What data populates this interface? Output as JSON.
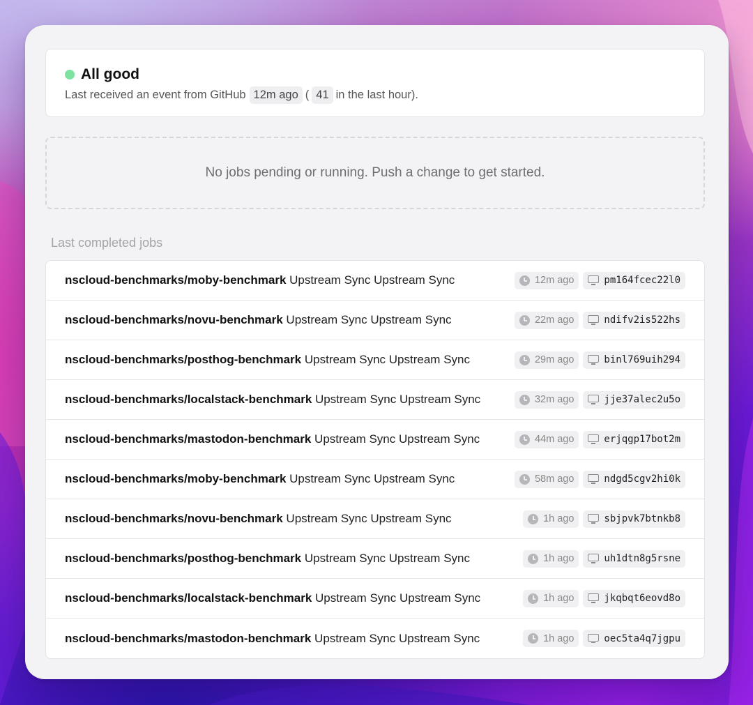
{
  "status": {
    "title": "All good",
    "line_prefix": "Last received an event from GitHub",
    "last_event": "12m ago",
    "open_paren": "(",
    "event_count": "41",
    "line_suffix": "in the last hour).",
    "indicator_color": "#7ee2a0"
  },
  "empty_state": {
    "message": "No jobs pending or running. Push a change to get started."
  },
  "completed": {
    "section_label": "Last completed jobs",
    "jobs": [
      {
        "repo": "nscloud-benchmarks/moby-benchmark",
        "title": "Upstream Sync Upstream Sync",
        "time": "12m ago",
        "id": "pm164fcec22l0"
      },
      {
        "repo": "nscloud-benchmarks/novu-benchmark",
        "title": "Upstream Sync Upstream Sync",
        "time": "22m ago",
        "id": "ndifv2is522hs"
      },
      {
        "repo": "nscloud-benchmarks/posthog-benchmark",
        "title": "Upstream Sync Upstream Sync",
        "time": "29m ago",
        "id": "binl769uih294"
      },
      {
        "repo": "nscloud-benchmarks/localstack-benchmark",
        "title": "Upstream Sync Upstream Sync",
        "time": "32m ago",
        "id": "jje37alec2u5o"
      },
      {
        "repo": "nscloud-benchmarks/mastodon-benchmark",
        "title": "Upstream Sync Upstream Sync",
        "time": "44m ago",
        "id": "erjqgp17bot2m"
      },
      {
        "repo": "nscloud-benchmarks/moby-benchmark",
        "title": "Upstream Sync Upstream Sync",
        "time": "58m ago",
        "id": "ndgd5cgv2hi0k"
      },
      {
        "repo": "nscloud-benchmarks/novu-benchmark",
        "title": "Upstream Sync Upstream Sync",
        "time": "1h ago",
        "id": "sbjpvk7btnkb8"
      },
      {
        "repo": "nscloud-benchmarks/posthog-benchmark",
        "title": "Upstream Sync Upstream Sync",
        "time": "1h ago",
        "id": "uh1dtn8g5rsne"
      },
      {
        "repo": "nscloud-benchmarks/localstack-benchmark",
        "title": "Upstream Sync Upstream Sync",
        "time": "1h ago",
        "id": "jkqbqt6eovd8o"
      },
      {
        "repo": "nscloud-benchmarks/mastodon-benchmark",
        "title": "Upstream Sync Upstream Sync",
        "time": "1h ago",
        "id": "oec5ta4q7jgpu"
      }
    ]
  }
}
